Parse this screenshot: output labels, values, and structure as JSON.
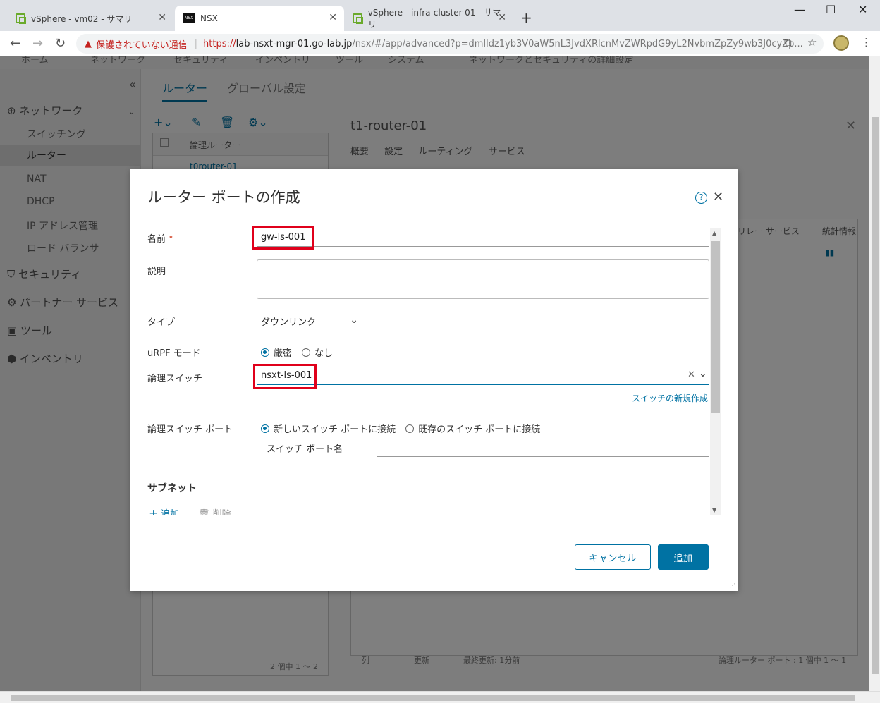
{
  "browser": {
    "tabs": [
      {
        "title": "vSphere - vm02 - サマリ"
      },
      {
        "title": "NSX"
      },
      {
        "title": "vSphere - infra-cluster-01 - サマリ"
      }
    ],
    "security_warning": "保護されていない通信",
    "url_scheme": "https://",
    "url_host": "lab-nsxt-mgr-01.go-lab.jp",
    "url_path": "/nsx/#/app/advanced?p=dmlldz1yb3V0aW5nL3JvdXRlcnMvZWRpdG9yL2NvbmZpZy9wb3J0cyZp..."
  },
  "app": {
    "topnav": [
      "ホーム",
      "ネットワーク",
      "セキュリティ",
      "インベントリ",
      "ツール",
      "システム",
      "ネットワークとセキュリティの詳細設定"
    ],
    "sidebar": {
      "network_group": "ネットワーク",
      "items": [
        "スイッチング",
        "ルーター",
        "NAT",
        "DHCP",
        "IP アドレス管理",
        "ロード バランサ"
      ],
      "groups": [
        "セキュリティ",
        "パートナー サービス",
        "ツール",
        "インベントリ"
      ]
    },
    "main_tabs": [
      "ルーター",
      "グローバル設定"
    ],
    "left_panel": {
      "column": "論理ルーター",
      "row1": "t0router-01",
      "footer": "2 個中 1 ～ 2"
    },
    "right_panel": {
      "title": "t1-router-01",
      "tabs": [
        "概要",
        "設定",
        "ルーティング",
        "サービス"
      ],
      "col_relay": "リレー サービス",
      "col_stats": "統計情報",
      "footer_cols": "列",
      "footer_refresh": "更新",
      "footer_updated": "最終更新: 1分前",
      "footer_right": "論理ルーター ポート : 1 個中 1 ～ 1"
    }
  },
  "modal": {
    "title": "ルーター ポートの作成",
    "name_label": "名前",
    "required_mark": "*",
    "name_value": "gw-ls-001",
    "description_label": "説明",
    "description_value": "",
    "type_label": "タイプ",
    "type_value": "ダウンリンク",
    "urpf_label": "uRPF モード",
    "urpf_options": [
      "厳密",
      "なし"
    ],
    "urpf_selected": "厳密",
    "ls_label": "論理スイッチ",
    "ls_value": "nsxt-ls-001",
    "new_switch_link": "スイッチの新規作成",
    "lsp_label": "論理スイッチ ポート",
    "lsp_options": [
      "新しいスイッチ ポートに接続",
      "既存のスイッチ ポートに接続"
    ],
    "lsp_selected": "新しいスイッチ ポートに接続",
    "switch_port_name_label": "スイッチ ポート名",
    "switch_port_name_value": "",
    "subnet_section": "サブネット",
    "add_action": "追加",
    "delete_action": "削除",
    "cancel_button": "キャンセル",
    "submit_button": "追加",
    "highlight_color": "#e0001b",
    "accent_color": "#0072a3"
  }
}
